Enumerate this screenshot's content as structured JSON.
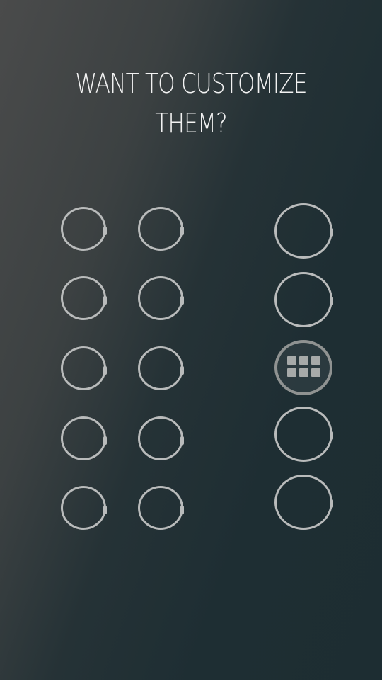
{
  "headline": {
    "line1": "WANT TO CUSTOMIZE",
    "line2": "THEM?"
  },
  "colors": {
    "ring": "#b9bbbb",
    "active_ring": "#8f9291",
    "text": "#f2f2f2"
  },
  "small_rings": {
    "rows": 5,
    "columns": 2
  },
  "large_rings": {
    "count": 5,
    "active_index": 2,
    "active_icon": "app-grid-icon"
  }
}
